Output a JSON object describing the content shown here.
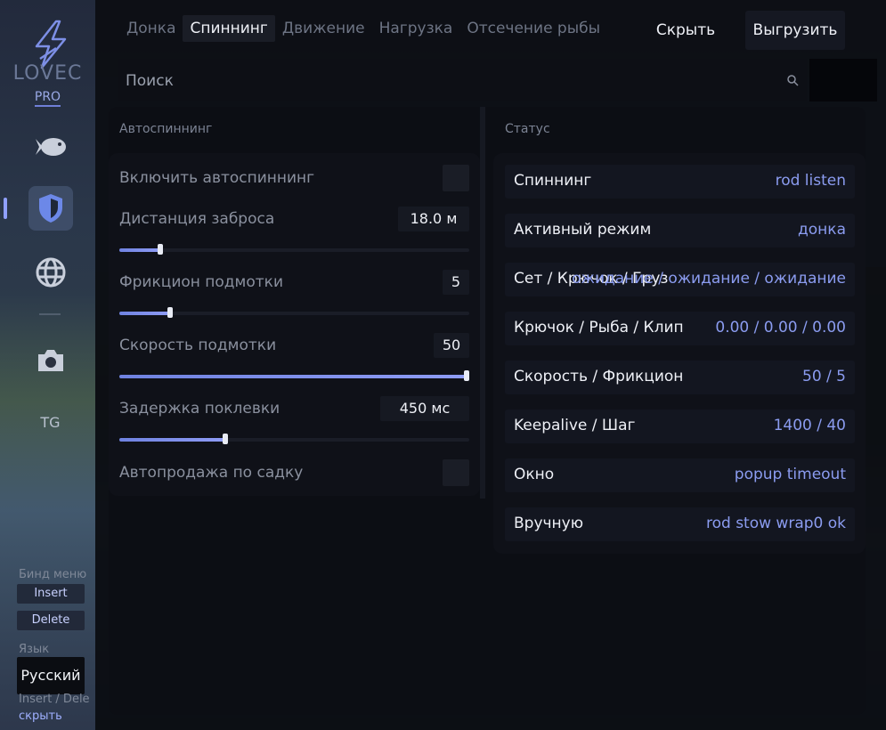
{
  "brand": {
    "name": "LOVEC",
    "tier": "PRO"
  },
  "sidebar": {
    "items": [
      {
        "icon": "fish-icon"
      },
      {
        "icon": "shield-icon",
        "active": true
      },
      {
        "icon": "globe-icon"
      },
      {
        "icon": "camera-icon"
      }
    ],
    "tg_label": "TG",
    "bind_menu_label": "Бинд меню",
    "bind_keys": [
      "Insert",
      "Delete"
    ],
    "language_label": "Язык",
    "language_value": "Русский",
    "hint_text": "Insert / Dele",
    "hide_link": "скрыть"
  },
  "tabs": [
    {
      "label": "Донка"
    },
    {
      "label": "Спиннинг",
      "active": true
    },
    {
      "label": "Движение"
    },
    {
      "label": "Нагрузка"
    },
    {
      "label": "Отсечение рыбы"
    }
  ],
  "header": {
    "hide_label": "Скрыть",
    "export_label": "Выгрузить"
  },
  "search": {
    "placeholder": "Поиск",
    "value": ""
  },
  "autospin": {
    "title": "Автоспиннинг",
    "enable_label": "Включить автоспиннинг",
    "enable_checked": false,
    "sliders": [
      {
        "label": "Дистанция заброса",
        "value_text": "18.0 м",
        "fraction": 0.11
      },
      {
        "label": "Фрикцион подмотки",
        "value_text": "5",
        "fraction": 0.14
      },
      {
        "label": "Скорость подмотки",
        "value_text": "50",
        "fraction": 1.0
      },
      {
        "label": "Задержка поклевки",
        "value_text": "450 мс",
        "fraction": 0.3
      }
    ],
    "autosell_label": "Автопродажа по садку",
    "autosell_checked": false
  },
  "status": {
    "title": "Статус",
    "rows": [
      {
        "label": "Спиннинг",
        "value": "rod listen"
      },
      {
        "label": "Активный режим",
        "value": "донка"
      },
      {
        "label": "Сет / Крючок / Груз",
        "value": "ожидание / ожидание / ожидание"
      },
      {
        "label": "Крючок / Рыба / Клип",
        "value": "0.00 / 0.00 / 0.00"
      },
      {
        "label": "Скорость / Фрикцион",
        "value": "50 / 5"
      },
      {
        "label": "Keepalive / Шаг",
        "value": "1400 / 40"
      },
      {
        "label": "Окно",
        "value": "popup timeout"
      },
      {
        "label": "Вручную",
        "value": "rod stow wrap0 ok"
      }
    ]
  },
  "colors": {
    "accent": "#8b9cf0",
    "panel": "#0b0d13",
    "slider": "#7585e4"
  }
}
